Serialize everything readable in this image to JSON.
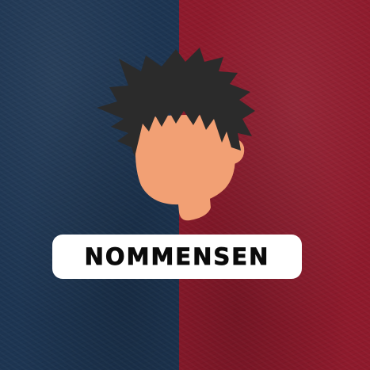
{
  "card": {
    "name": "NOMMENSEN"
  },
  "colors": {
    "left_panel": "#1d3552",
    "right_panel": "#8e1a2c",
    "hair": "#2b2b2b",
    "skin": "#f2a074",
    "pill": "#ffffff",
    "name_text": "#0b0b0b"
  },
  "icons": {
    "avatar": "player-silhouette-icon"
  }
}
